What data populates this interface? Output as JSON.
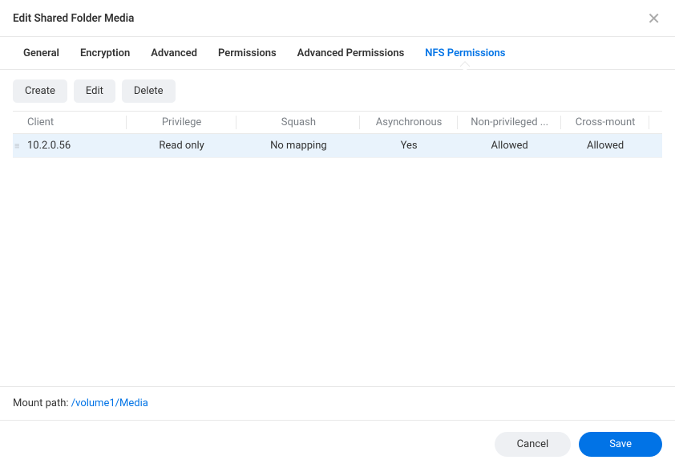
{
  "dialog_title": "Edit Shared Folder Media",
  "tabs": {
    "general": "General",
    "encryption": "Encryption",
    "advanced": "Advanced",
    "permissions": "Permissions",
    "advanced_permissions": "Advanced Permissions",
    "nfs_permissions": "NFS Permissions"
  },
  "toolbar": {
    "create": "Create",
    "edit": "Edit",
    "delete": "Delete"
  },
  "table": {
    "headers": {
      "client": "Client",
      "privilege": "Privilege",
      "squash": "Squash",
      "asynchronous": "Asynchronous",
      "non_privileged": "Non-privileged ...",
      "cross_mount": "Cross-mount"
    },
    "rows": [
      {
        "client": "10.2.0.56",
        "privilege": "Read only",
        "squash": "No mapping",
        "asynchronous": "Yes",
        "non_privileged": "Allowed",
        "cross_mount": "Allowed"
      }
    ]
  },
  "mount_path": {
    "label": "Mount path: ",
    "value": "/volume1/Media"
  },
  "footer": {
    "cancel": "Cancel",
    "save": "Save"
  }
}
